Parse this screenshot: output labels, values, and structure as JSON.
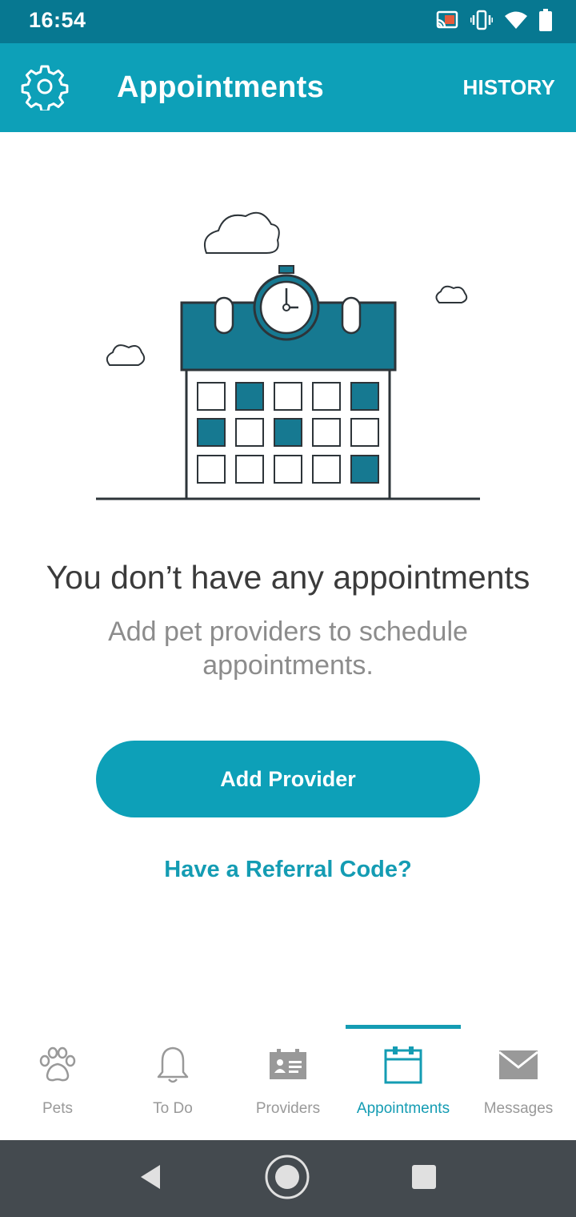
{
  "status_bar": {
    "time": "16:54",
    "icons": [
      "cast-icon",
      "vibrate-icon",
      "wifi-icon",
      "battery-icon"
    ]
  },
  "app_bar": {
    "title": "Appointments",
    "history_label": "HISTORY",
    "settings_icon": "gear-icon"
  },
  "empty_state": {
    "title": "You don’t have any appointments",
    "subtitle": "Add pet providers to schedule appointments.",
    "illustration": "calendar-clock-illustration"
  },
  "actions": {
    "add_provider_label": "Add Provider",
    "referral_label": "Have a Referral Code?"
  },
  "bottom_nav": {
    "items": [
      {
        "label": "Pets",
        "icon": "paw-icon",
        "active": false
      },
      {
        "label": "To Do",
        "icon": "bell-icon",
        "active": false
      },
      {
        "label": "Providers",
        "icon": "id-card-icon",
        "active": false
      },
      {
        "label": "Appointments",
        "icon": "calendar-icon",
        "active": true
      },
      {
        "label": "Messages",
        "icon": "envelope-icon",
        "active": false
      }
    ]
  },
  "system_nav": {
    "icons": [
      "back-icon",
      "home-icon",
      "recents-icon"
    ]
  },
  "colors": {
    "status_bar": "#077891",
    "app_bar": "#0da0b8",
    "accent": "#149cb3",
    "calendar_dark": "#167991",
    "inactive": "#999999",
    "system_nav": "#444a4f"
  }
}
